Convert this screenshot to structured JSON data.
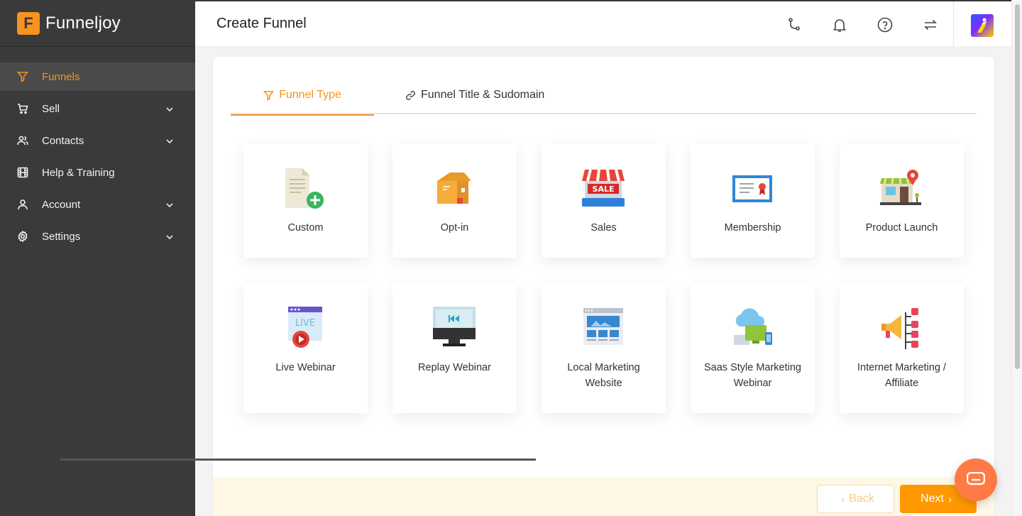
{
  "brand": {
    "logo_letter": "F",
    "name": "Funneljoy",
    "accent": "#f7931e"
  },
  "sidebar": {
    "items": [
      {
        "label": "Funnels",
        "icon": "funnel-icon",
        "active": true,
        "has_chevron": false
      },
      {
        "label": "Sell",
        "icon": "cart-icon",
        "active": false,
        "has_chevron": true
      },
      {
        "label": "Contacts",
        "icon": "users-icon",
        "active": false,
        "has_chevron": true
      },
      {
        "label": "Help & Training",
        "icon": "film-icon",
        "active": false,
        "has_chevron": false
      },
      {
        "label": "Account",
        "icon": "user-icon",
        "active": false,
        "has_chevron": true
      },
      {
        "label": "Settings",
        "icon": "gear-icon",
        "active": false,
        "has_chevron": true
      }
    ]
  },
  "header": {
    "title": "Create Funnel",
    "icons": [
      "git-branch-icon",
      "bell-icon",
      "help-circle-icon",
      "refresh-icon",
      "avatar"
    ]
  },
  "tabs": [
    {
      "label": "Funnel Type",
      "icon": "funnel-icon",
      "active": true
    },
    {
      "label": "Funnel Title & Sudomain",
      "icon": "link-icon",
      "active": false
    }
  ],
  "funnel_types": [
    {
      "label": "Custom",
      "icon": "document-add-icon"
    },
    {
      "label": "Opt-in",
      "icon": "box-icon"
    },
    {
      "label": "Sales",
      "icon": "sale-store-icon"
    },
    {
      "label": "Membership",
      "icon": "certificate-icon"
    },
    {
      "label": "Product Launch",
      "icon": "shop-location-icon"
    },
    {
      "label": "Live Webinar",
      "icon": "live-video-icon"
    },
    {
      "label": "Replay Webinar",
      "icon": "replay-monitor-icon"
    },
    {
      "label": "Local Marketing Website",
      "icon": "website-layout-icon"
    },
    {
      "label": "Saas Style Marketing Webinar",
      "icon": "cloud-devices-icon"
    },
    {
      "label": "Internet Marketing / Affiliate",
      "icon": "megaphone-network-icon"
    }
  ],
  "footer": {
    "back_label": "Back",
    "next_label": "Next",
    "back_chevron": "‹",
    "next_chevron": "›"
  }
}
